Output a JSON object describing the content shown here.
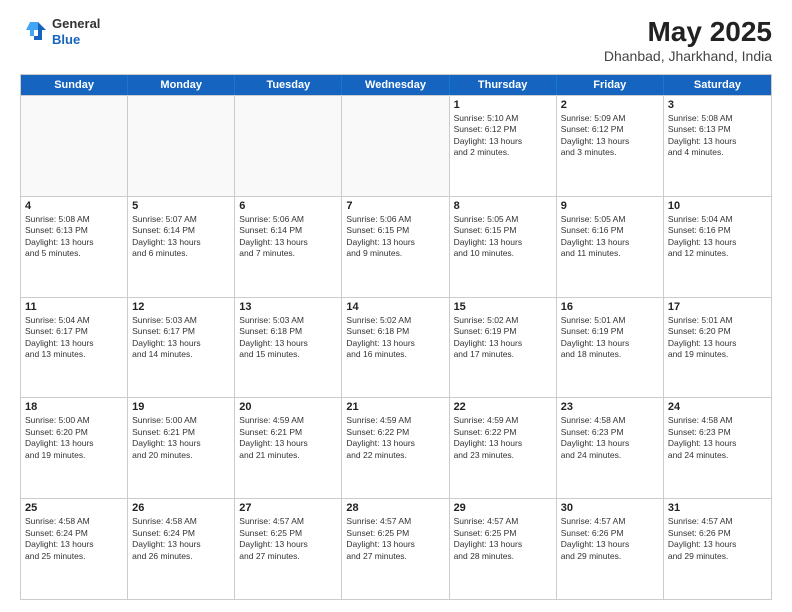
{
  "header": {
    "logo_general": "General",
    "logo_blue": "Blue",
    "title": "May 2025",
    "location": "Dhanbad, Jharkhand, India"
  },
  "weekdays": [
    "Sunday",
    "Monday",
    "Tuesday",
    "Wednesday",
    "Thursday",
    "Friday",
    "Saturday"
  ],
  "rows": [
    [
      {
        "day": "",
        "info": "",
        "empty": true
      },
      {
        "day": "",
        "info": "",
        "empty": true
      },
      {
        "day": "",
        "info": "",
        "empty": true
      },
      {
        "day": "",
        "info": "",
        "empty": true
      },
      {
        "day": "1",
        "info": "Sunrise: 5:10 AM\nSunset: 6:12 PM\nDaylight: 13 hours\nand 2 minutes."
      },
      {
        "day": "2",
        "info": "Sunrise: 5:09 AM\nSunset: 6:12 PM\nDaylight: 13 hours\nand 3 minutes."
      },
      {
        "day": "3",
        "info": "Sunrise: 5:08 AM\nSunset: 6:13 PM\nDaylight: 13 hours\nand 4 minutes."
      }
    ],
    [
      {
        "day": "4",
        "info": "Sunrise: 5:08 AM\nSunset: 6:13 PM\nDaylight: 13 hours\nand 5 minutes."
      },
      {
        "day": "5",
        "info": "Sunrise: 5:07 AM\nSunset: 6:14 PM\nDaylight: 13 hours\nand 6 minutes."
      },
      {
        "day": "6",
        "info": "Sunrise: 5:06 AM\nSunset: 6:14 PM\nDaylight: 13 hours\nand 7 minutes."
      },
      {
        "day": "7",
        "info": "Sunrise: 5:06 AM\nSunset: 6:15 PM\nDaylight: 13 hours\nand 9 minutes."
      },
      {
        "day": "8",
        "info": "Sunrise: 5:05 AM\nSunset: 6:15 PM\nDaylight: 13 hours\nand 10 minutes."
      },
      {
        "day": "9",
        "info": "Sunrise: 5:05 AM\nSunset: 6:16 PM\nDaylight: 13 hours\nand 11 minutes."
      },
      {
        "day": "10",
        "info": "Sunrise: 5:04 AM\nSunset: 6:16 PM\nDaylight: 13 hours\nand 12 minutes."
      }
    ],
    [
      {
        "day": "11",
        "info": "Sunrise: 5:04 AM\nSunset: 6:17 PM\nDaylight: 13 hours\nand 13 minutes."
      },
      {
        "day": "12",
        "info": "Sunrise: 5:03 AM\nSunset: 6:17 PM\nDaylight: 13 hours\nand 14 minutes."
      },
      {
        "day": "13",
        "info": "Sunrise: 5:03 AM\nSunset: 6:18 PM\nDaylight: 13 hours\nand 15 minutes."
      },
      {
        "day": "14",
        "info": "Sunrise: 5:02 AM\nSunset: 6:18 PM\nDaylight: 13 hours\nand 16 minutes."
      },
      {
        "day": "15",
        "info": "Sunrise: 5:02 AM\nSunset: 6:19 PM\nDaylight: 13 hours\nand 17 minutes."
      },
      {
        "day": "16",
        "info": "Sunrise: 5:01 AM\nSunset: 6:19 PM\nDaylight: 13 hours\nand 18 minutes."
      },
      {
        "day": "17",
        "info": "Sunrise: 5:01 AM\nSunset: 6:20 PM\nDaylight: 13 hours\nand 19 minutes."
      }
    ],
    [
      {
        "day": "18",
        "info": "Sunrise: 5:00 AM\nSunset: 6:20 PM\nDaylight: 13 hours\nand 19 minutes."
      },
      {
        "day": "19",
        "info": "Sunrise: 5:00 AM\nSunset: 6:21 PM\nDaylight: 13 hours\nand 20 minutes."
      },
      {
        "day": "20",
        "info": "Sunrise: 4:59 AM\nSunset: 6:21 PM\nDaylight: 13 hours\nand 21 minutes."
      },
      {
        "day": "21",
        "info": "Sunrise: 4:59 AM\nSunset: 6:22 PM\nDaylight: 13 hours\nand 22 minutes."
      },
      {
        "day": "22",
        "info": "Sunrise: 4:59 AM\nSunset: 6:22 PM\nDaylight: 13 hours\nand 23 minutes."
      },
      {
        "day": "23",
        "info": "Sunrise: 4:58 AM\nSunset: 6:23 PM\nDaylight: 13 hours\nand 24 minutes."
      },
      {
        "day": "24",
        "info": "Sunrise: 4:58 AM\nSunset: 6:23 PM\nDaylight: 13 hours\nand 24 minutes."
      }
    ],
    [
      {
        "day": "25",
        "info": "Sunrise: 4:58 AM\nSunset: 6:24 PM\nDaylight: 13 hours\nand 25 minutes."
      },
      {
        "day": "26",
        "info": "Sunrise: 4:58 AM\nSunset: 6:24 PM\nDaylight: 13 hours\nand 26 minutes."
      },
      {
        "day": "27",
        "info": "Sunrise: 4:57 AM\nSunset: 6:25 PM\nDaylight: 13 hours\nand 27 minutes."
      },
      {
        "day": "28",
        "info": "Sunrise: 4:57 AM\nSunset: 6:25 PM\nDaylight: 13 hours\nand 27 minutes."
      },
      {
        "day": "29",
        "info": "Sunrise: 4:57 AM\nSunset: 6:25 PM\nDaylight: 13 hours\nand 28 minutes."
      },
      {
        "day": "30",
        "info": "Sunrise: 4:57 AM\nSunset: 6:26 PM\nDaylight: 13 hours\nand 29 minutes."
      },
      {
        "day": "31",
        "info": "Sunrise: 4:57 AM\nSunset: 6:26 PM\nDaylight: 13 hours\nand 29 minutes."
      }
    ]
  ]
}
